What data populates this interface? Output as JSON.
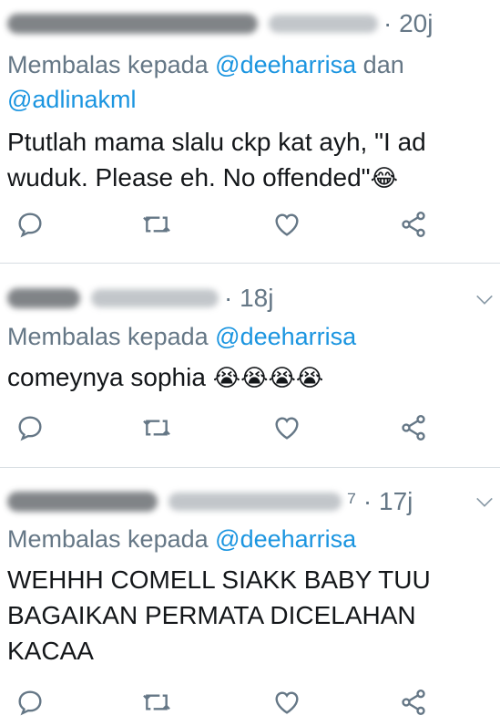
{
  "tweets": [
    {
      "time": "· 20j",
      "reply_prefix": "Membalas kepada",
      "mentions": [
        "@deeharrisa",
        "@adlinakml"
      ],
      "joiner": "dan",
      "text_line1": "Ptutlah mama slalu ckp kat ayh, \"I ad",
      "text_line2": "wuduk. Please eh. No offended\"",
      "emoji": "😂"
    },
    {
      "time": "· 18j",
      "reply_prefix": "Membalas kepada",
      "mentions": [
        "@deeharrisa"
      ],
      "text": "comeynya sophia",
      "emoji": "😭😭😭😭"
    },
    {
      "time": "⁷ · 17j",
      "reply_prefix": "Membalas kepada",
      "mentions": [
        "@deeharrisa"
      ],
      "text_line1": "WEHHH COMELL SIAKK BABY TUU",
      "text_line2": "BAGAIKAN PERMATA DICELAHAN",
      "text_line3": "KACAA"
    }
  ],
  "icons": {
    "reply": "reply-icon",
    "retweet": "retweet-icon",
    "like": "heart-icon",
    "share": "share-icon",
    "caret": "chevron-down-icon"
  },
  "colors": {
    "text": "#14171a",
    "secondary": "#657786",
    "link": "#1b95e0",
    "divider": "#d7dde2"
  }
}
